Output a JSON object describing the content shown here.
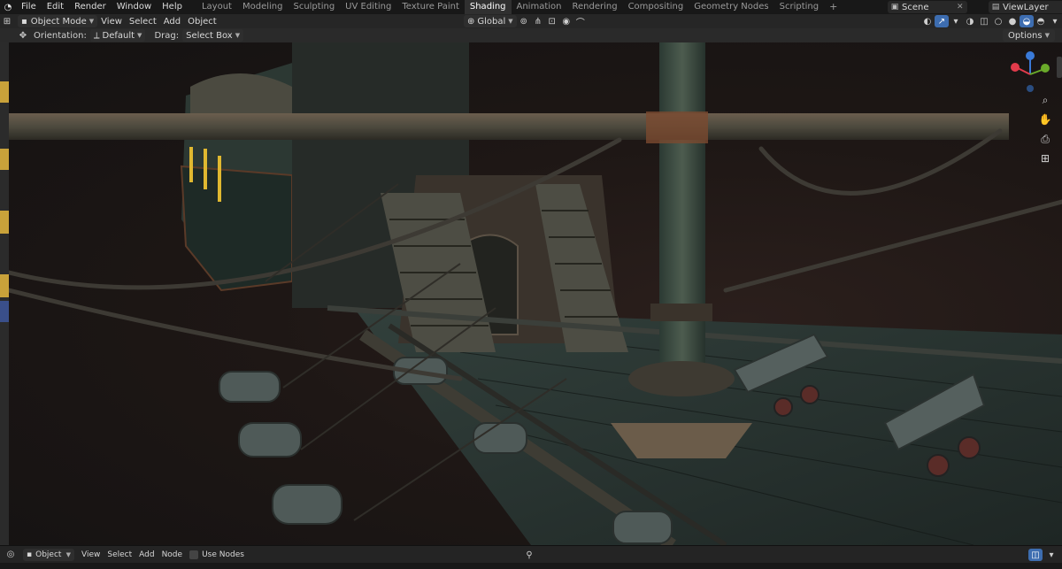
{
  "menu": {
    "items": [
      "File",
      "Edit",
      "Render",
      "Window",
      "Help"
    ]
  },
  "workspaces": {
    "tabs": [
      "Layout",
      "Modeling",
      "Sculpting",
      "UV Editing",
      "Texture Paint",
      "Shading",
      "Animation",
      "Rendering",
      "Compositing",
      "Geometry Nodes",
      "Scripting"
    ],
    "active": "Shading",
    "add_label": "+"
  },
  "scene": {
    "name": "Scene"
  },
  "view_layer": {
    "name": "ViewLayer"
  },
  "viewport_header": {
    "mode": "Object Mode",
    "menus": [
      "View",
      "Select",
      "Add",
      "Object"
    ],
    "transform_orientation": "Global"
  },
  "tool_settings": {
    "orientation_label": "Orientation:",
    "orientation_value": "Default",
    "drag_label": "Drag:",
    "drag_value": "Select Box",
    "options_label": "Options"
  },
  "node_editor_header": {
    "object_type": "Object",
    "menus": [
      "View",
      "Select",
      "Add",
      "Node"
    ],
    "use_nodes_label": "Use Nodes"
  },
  "colors": {
    "accent": "#3d6db0",
    "active_tab": "#303030",
    "axis_x": "#e23b4b",
    "axis_y": "#6aaa2a",
    "axis_z": "#3a7ad8"
  }
}
